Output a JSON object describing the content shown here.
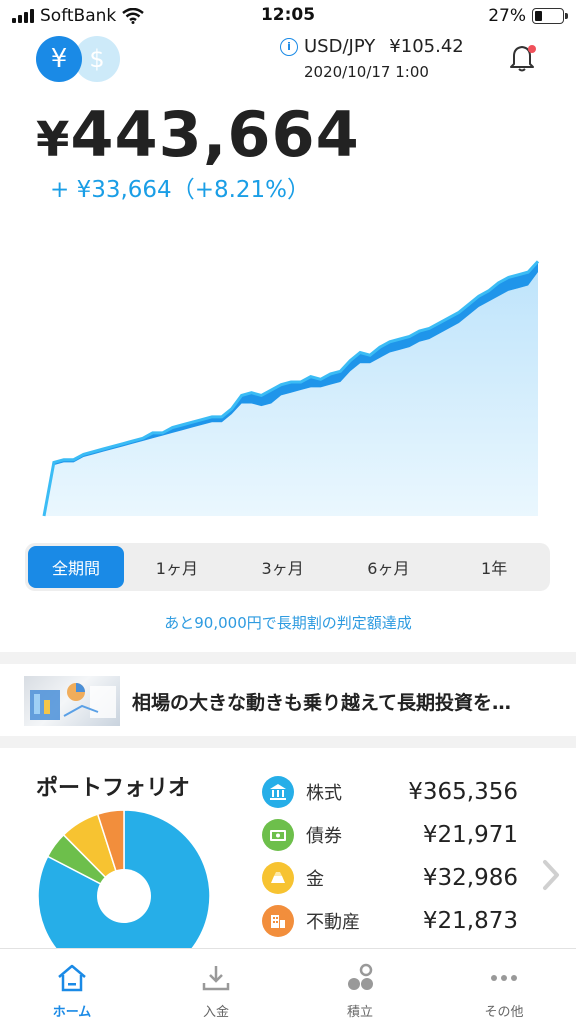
{
  "status_bar": {
    "carrier": "SoftBank",
    "time": "12:05",
    "battery": "27%"
  },
  "header": {
    "currency_primary_symbol": "¥",
    "currency_secondary_symbol": "$",
    "pair": "USD/JPY",
    "rate": "¥105.42",
    "datetime": "2020/10/17 1:00",
    "info_icon": "info-icon",
    "bell_icon": "bell-icon"
  },
  "summary": {
    "total_symbol": "¥",
    "total_value": "443,664",
    "gain_text": "+ ¥33,664（+8.21%）"
  },
  "colors": {
    "accent": "#1a8ae6",
    "gain": "#1a9ee6",
    "chart_line": "#29a8f0",
    "chart_fill": "#d6effc"
  },
  "chart_data": {
    "type": "area",
    "x_label": "",
    "y_label": "",
    "x": [
      0,
      2,
      4,
      6,
      8,
      10,
      12,
      14,
      16,
      18,
      20,
      22,
      24,
      26,
      28,
      30,
      32,
      34,
      36,
      38,
      40,
      42,
      44,
      46,
      48,
      50,
      52,
      54,
      56,
      58,
      60,
      62,
      64,
      66,
      68,
      70,
      72,
      74,
      76,
      78,
      80,
      82,
      84,
      86,
      88,
      90,
      92,
      94,
      96,
      98,
      100
    ],
    "series": [
      {
        "name": "",
        "kind": "value",
        "values": [
          0,
          20,
          21,
          21,
          23,
          24,
          25,
          26,
          27,
          28,
          29,
          31,
          31,
          33,
          34,
          35,
          36,
          37,
          37,
          40,
          45,
          46,
          45,
          47,
          49,
          50,
          50,
          52,
          51,
          53,
          54,
          58,
          61,
          60,
          63,
          65,
          66,
          67,
          69,
          70,
          72,
          74,
          76,
          79,
          82,
          84,
          87,
          89,
          90,
          91,
          95
        ]
      },
      {
        "name": "",
        "kind": "principal",
        "values": [
          0,
          19,
          20,
          20,
          22,
          23,
          24,
          25,
          26,
          27,
          28,
          29,
          30,
          31,
          32,
          33,
          34,
          35,
          35,
          38,
          42,
          42,
          41,
          42,
          45,
          46,
          47,
          48,
          48,
          49,
          50,
          54,
          57,
          57,
          59,
          61,
          62,
          63,
          65,
          66,
          68,
          70,
          72,
          75,
          78,
          80,
          82,
          84,
          85,
          86,
          91
        ]
      }
    ],
    "ylim": [
      0,
      100
    ]
  },
  "periods": {
    "active": "全期間",
    "items": [
      "全期間",
      "1ヶ月",
      "3ヶ月",
      "6ヶ月",
      "1年"
    ]
  },
  "notice": "あと90,000円で長期割の判定額達成",
  "news": {
    "title": "相場の大きな動きも乗り越えて長期投資を…"
  },
  "portfolio": {
    "title": "ポートフォリオ",
    "assets": [
      {
        "label": "株式",
        "value": "¥365,356",
        "amount": 365356,
        "color": "#26aee8",
        "icon": "bank-icon"
      },
      {
        "label": "債券",
        "value": "¥21,971",
        "amount": 21971,
        "color": "#6dbf4b",
        "icon": "bond-icon"
      },
      {
        "label": "金",
        "value": "¥32,986",
        "amount": 32986,
        "color": "#f7c331",
        "icon": "gold-icon"
      },
      {
        "label": "不動産",
        "value": "¥21,873",
        "amount": 21873,
        "color": "#f28e3c",
        "icon": "building-icon"
      }
    ]
  },
  "tabbar": {
    "items": [
      {
        "label": "ホーム",
        "icon": "home-icon",
        "active": true
      },
      {
        "label": "入金",
        "icon": "deposit-icon",
        "active": false
      },
      {
        "label": "積立",
        "icon": "savings-icon",
        "active": false
      },
      {
        "label": "その他",
        "icon": "more-icon",
        "active": false
      }
    ]
  }
}
